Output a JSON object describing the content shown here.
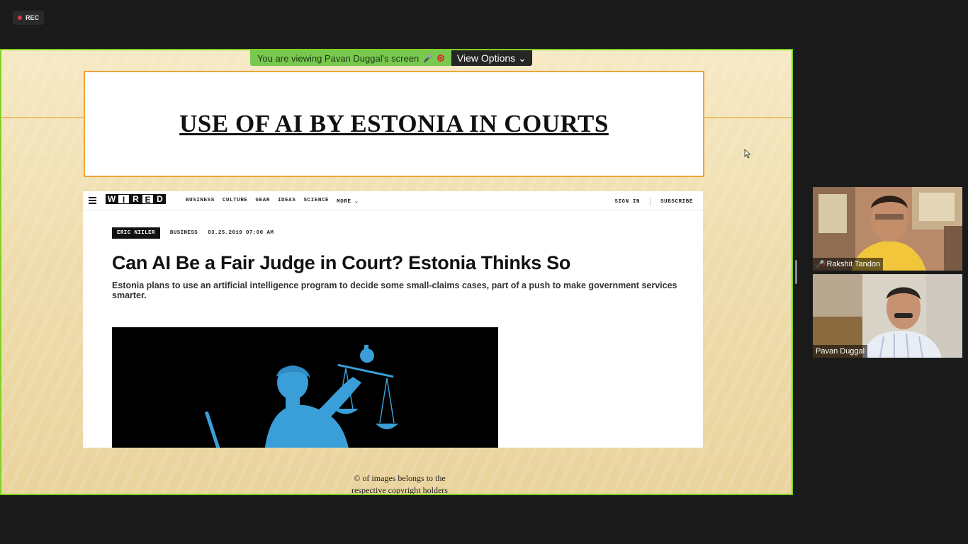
{
  "recording": {
    "label": "REC"
  },
  "share_banner": {
    "message": "You are viewing Pavan Duggal's screen",
    "view_options": "View Options",
    "accent": "#7ed321"
  },
  "slide": {
    "title": "USE OF AI BY ESTONIA IN COURTS",
    "copyright_line1": "© of images belongs to the",
    "copyright_line2": "respective copyright holders"
  },
  "wired": {
    "logo_letters": [
      "W",
      "I",
      "R",
      "E",
      "D"
    ],
    "nav": [
      "BUSINESS",
      "CULTURE",
      "GEAR",
      "IDEAS",
      "SCIENCE",
      "MORE"
    ],
    "sign_in": "SIGN IN",
    "subscribe": "SUBSCRIBE",
    "author": "ERIC NIILER",
    "section": "BUSINESS",
    "date": "03.25.2019 07:00 AM",
    "headline": "Can AI Be a Fair Judge in Court? Estonia Thinks So",
    "dek": "Estonia plans to use an artificial intelligence program to decide some small-claims cases, part of a push to make government services smarter."
  },
  "participants": [
    {
      "name": "Rakshit Tandon",
      "muted": true,
      "icon": "mic-muted-icon"
    },
    {
      "name": "Pavan Duggal",
      "muted": false
    }
  ]
}
